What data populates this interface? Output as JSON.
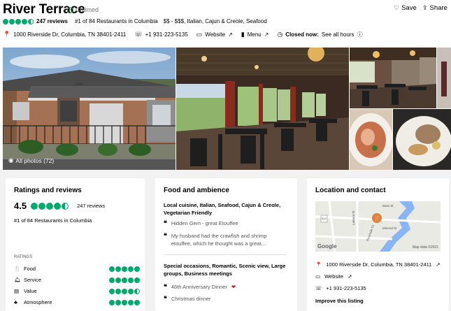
{
  "header": {
    "title": "River Terrace",
    "claimed": "Claimed",
    "save": "Save",
    "share": "Share",
    "rating_bubbles": 5,
    "reviews": "247 reviews",
    "rank": "#1 of 84 Restaurants in Columbia",
    "price": "$$ - $$$, Italian, Cajun & Creole, Seafood",
    "address": "1000 Riverside Dr, Columbia, TN 38401-2411",
    "phone": "+1 931-223-5135",
    "website": "Website",
    "menu": "Menu",
    "closed_now": "Closed now:",
    "see_all_hours": "See all hours"
  },
  "gallery": {
    "all_photos": "All photos (72)",
    "building_sign": "1000"
  },
  "ratings": {
    "title": "Ratings and reviews",
    "score": "4.5",
    "reviews": "247 reviews",
    "rank": "#1 of 84 Restaurants in Columbia",
    "section_label": "RATINGS",
    "items": [
      {
        "label": "Food",
        "value": 5
      },
      {
        "label": "Service",
        "value": 5
      },
      {
        "label": "Value",
        "value": 4.5
      },
      {
        "label": "Atmosphere",
        "value": 5
      }
    ]
  },
  "food": {
    "title": "Food and ambience",
    "cuisine": "Local cuisine, Italian, Seafood, Cajun & Creole, Vegetarian Friendly",
    "quote1": "Hidden Gem - great Etouffee",
    "quote2a": "My husband had the crawfish and shrimp",
    "quote2b": "etouffee, which he thought was a great...",
    "occasions": "Special occasions, Romantic, Scenic view, Large groups, Business meetings",
    "quote3": "46th Anniversary Dinner",
    "quote4": "Christmas dinner"
  },
  "location": {
    "title": "Location and contact",
    "map_data": "Map data ©2021",
    "map_brand": "Google",
    "address": "1000 Riverside Dr, Columbia, TN 38401-2411",
    "website": "Website",
    "phone": "+1 931-223-5135",
    "improve": "Improve this listing",
    "street1": "Bass St",
    "street2": "Lamont St",
    "street3": "Riverside Dr",
    "street4": "Mineral St",
    "road_shield": "412"
  }
}
